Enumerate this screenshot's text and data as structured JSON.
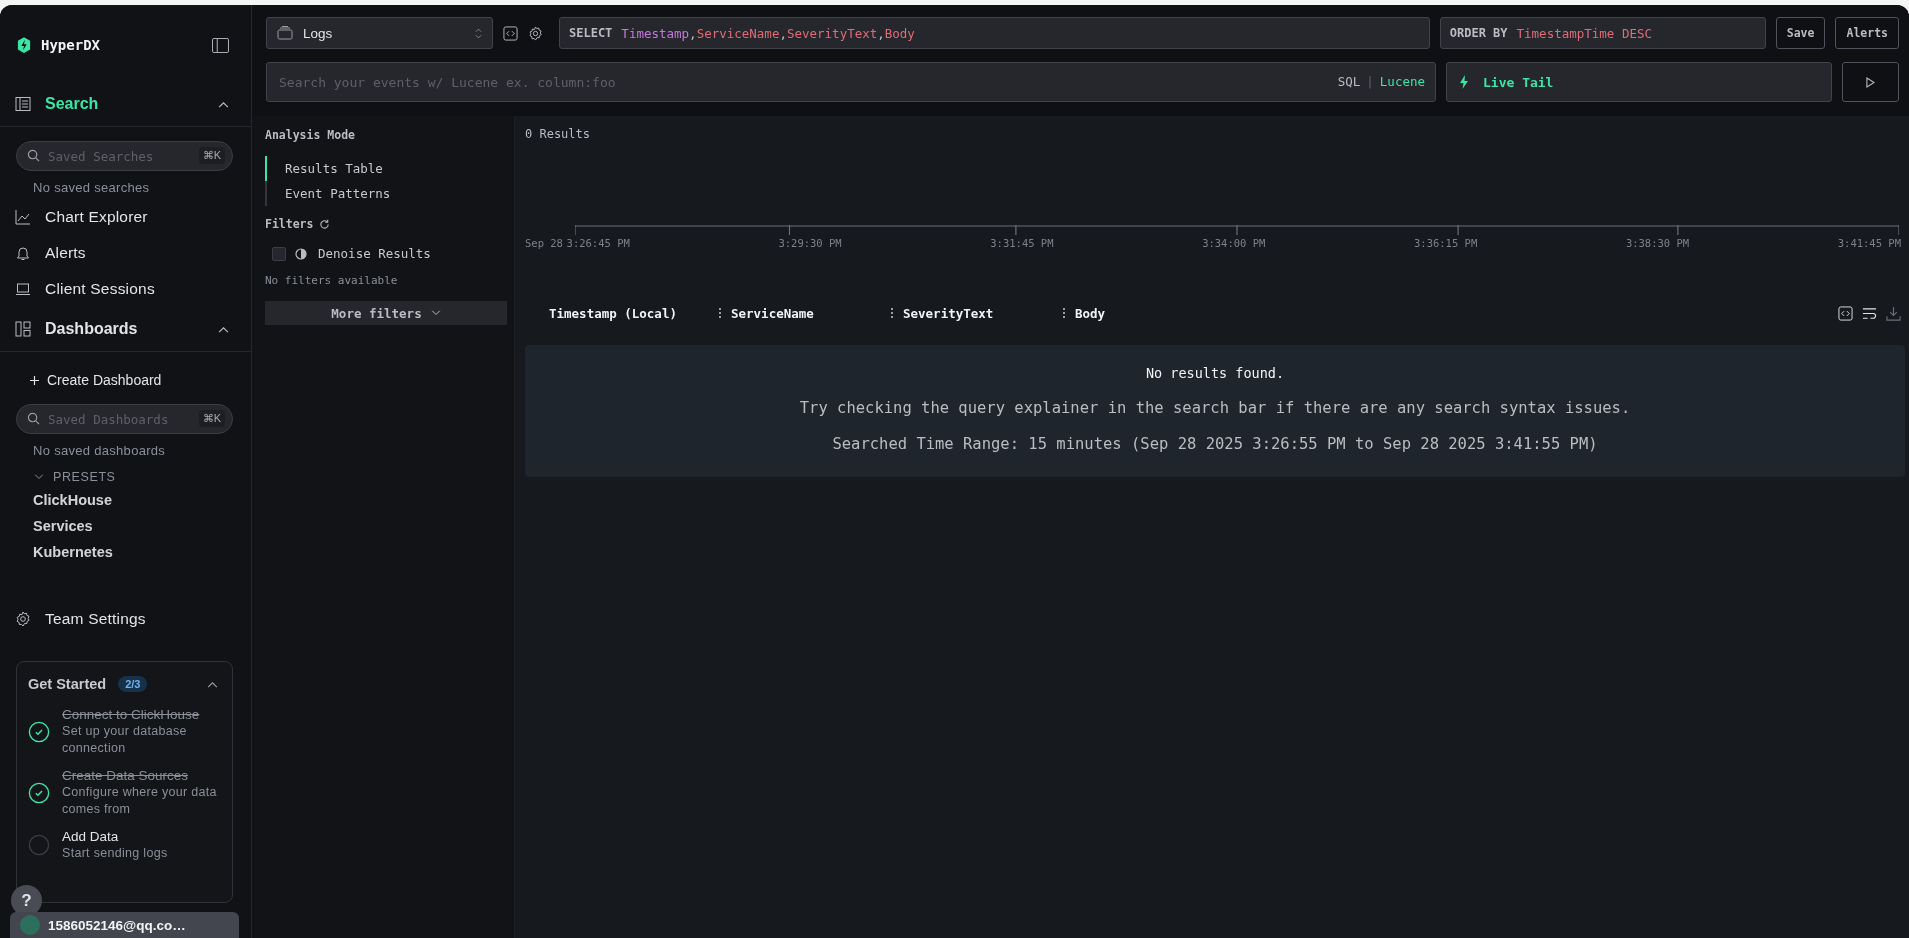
{
  "sidebar": {
    "brand": "HyperDX",
    "search_section": {
      "label": "Search",
      "selected": true,
      "expanded": true,
      "field": {
        "placeholder": "Saved Searches",
        "shortcut": "⌘K"
      },
      "empty": "No saved searches"
    },
    "links": [
      {
        "label": "Chart Explorer"
      },
      {
        "label": "Alerts"
      },
      {
        "label": "Client Sessions"
      }
    ],
    "dashboards_section": {
      "label": "Dashboards",
      "selected": false,
      "expanded": true,
      "create": "Create Dashboard",
      "field": {
        "placeholder": "Saved Dashboards",
        "shortcut": "⌘K"
      },
      "empty": "No saved dashboards",
      "presets": {
        "label": "PRESETS",
        "expanded": true,
        "items": [
          "ClickHouse",
          "Services",
          "Kubernetes"
        ]
      }
    },
    "team_settings": "Team Settings",
    "get_started": {
      "title": "Get Started",
      "progress": "2/3",
      "expanded": true,
      "steps": [
        {
          "title": "Connect to ClickHouse",
          "description": "Set up your database connection",
          "done": true
        },
        {
          "title": "Create Data Sources",
          "description": "Configure where your data comes from",
          "done": true
        },
        {
          "title": "Add Data",
          "description": "Start sending logs",
          "done": false
        }
      ]
    },
    "help": "?",
    "user": {
      "email": "1586052146@qq.co…"
    }
  },
  "toolbar": {
    "source": "Logs",
    "select": {
      "keyword": "SELECT",
      "separator": ",",
      "columns": [
        {
          "name": "Timestamp",
          "color": "#c678dd"
        },
        {
          "name": "ServiceName",
          "color": "#e06c75"
        },
        {
          "name": "SeverityText",
          "color": "#e06c75"
        },
        {
          "name": "Body",
          "color": "#e06c75"
        }
      ]
    },
    "order_by": {
      "keyword": "ORDER BY",
      "value": "TimestampTime DESC"
    },
    "buttons": [
      "Save",
      "Alerts"
    ],
    "search": {
      "placeholder": "Search your events w/ Lucene ex. column:foo",
      "separator": "|",
      "languages": [
        {
          "label": "SQL",
          "selected": false
        },
        {
          "label": "Lucene",
          "selected": true
        }
      ]
    },
    "live_tail": "Live Tail"
  },
  "analysis_mode": {
    "title": "Analysis Mode",
    "options": [
      {
        "label": "Results Table",
        "selected": true
      },
      {
        "label": "Event Patterns",
        "selected": false
      }
    ]
  },
  "filters": {
    "title": "Filters",
    "options": [
      {
        "label": "Denoise Results",
        "checked": false
      }
    ],
    "empty": "No filters available",
    "more": "More filters"
  },
  "histogram": {
    "results": "0 Results",
    "date_label": "Sep 28",
    "ticks": [
      "3:26:45 PM",
      "3:29:30 PM",
      "3:31:45 PM",
      "3:34:00 PM",
      "3:36:15 PM",
      "3:38:30 PM",
      "3:41:45 PM"
    ]
  },
  "table": {
    "columns": [
      "Timestamp (Local)",
      "ServiceName",
      "SeverityText",
      "Body"
    ],
    "empty": {
      "title": "No results found.",
      "hint": "Try checking the query explainer in the search bar if there are any search syntax issues.",
      "range": "Searched Time Range: 15 minutes (Sep 28 2025 3:26:55 PM to Sep 28 2025 3:41:55 PM)"
    }
  }
}
